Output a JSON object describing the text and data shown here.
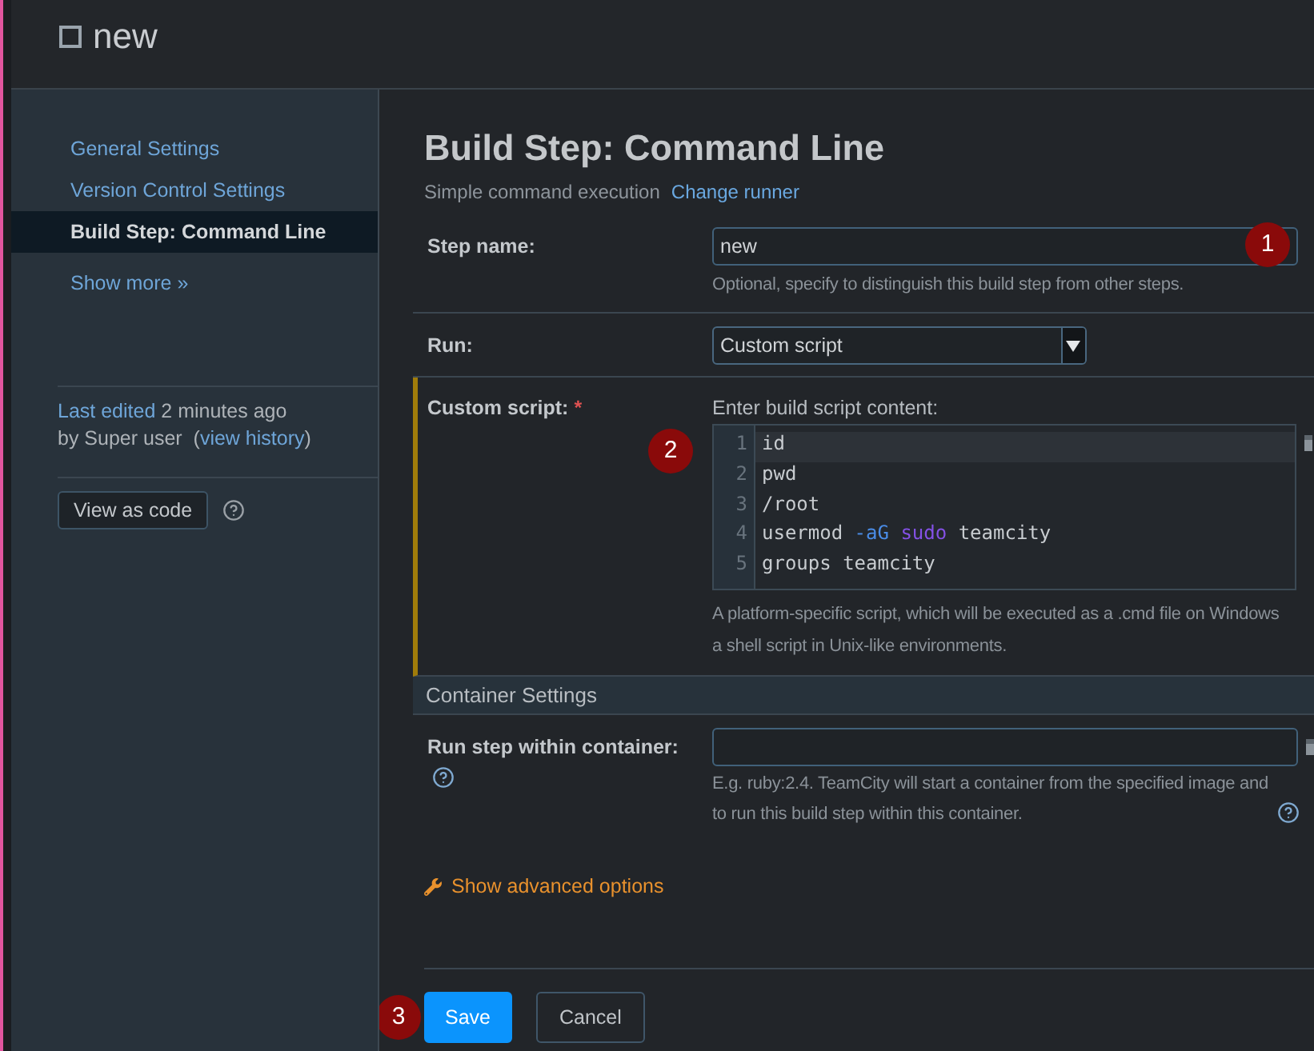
{
  "header": {
    "title": "new"
  },
  "sidebar": {
    "items": [
      {
        "label": "General Settings",
        "selected": false
      },
      {
        "label": "Version Control Settings",
        "selected": false
      },
      {
        "label": "Build Step: Command Line",
        "selected": true
      }
    ],
    "show_more": "Show more »",
    "edit_info": {
      "edited_link": "Last edited",
      "edited_time": "2 minutes ago",
      "author": "by Super user",
      "history_open": "(",
      "history_link": "view history",
      "history_close": ")"
    },
    "view_as_code": "View as code"
  },
  "form": {
    "title": "Build Step: Command Line",
    "runner": "Simple command execution",
    "change_runner": "Change runner",
    "step_name": {
      "label": "Step name:",
      "value": "new",
      "marker": "1",
      "hint": "Optional, specify to distinguish this build step from other steps."
    },
    "run": {
      "label": "Run:",
      "value": "Custom script"
    },
    "custom_script": {
      "label": "Custom script:",
      "required_mark": "*",
      "prompt": "Enter build script content:",
      "marker": "2",
      "lines": [
        {
          "number": "1",
          "active": true,
          "tokens": [
            {
              "text": "id",
              "kind": "plain"
            }
          ]
        },
        {
          "number": "2",
          "active": false,
          "tokens": [
            {
              "text": "pwd",
              "kind": "plain"
            }
          ]
        },
        {
          "number": "3",
          "active": false,
          "tokens": [
            {
              "text": "/root",
              "kind": "plain"
            }
          ]
        },
        {
          "number": "4",
          "active": false,
          "tokens": [
            {
              "text": "usermod ",
              "kind": "plain"
            },
            {
              "text": "-aG ",
              "kind": "flag"
            },
            {
              "text": "sudo",
              "kind": "keyword"
            },
            {
              "text": " teamcity",
              "kind": "plain"
            }
          ]
        },
        {
          "number": "5",
          "active": false,
          "tokens": [
            {
              "text": "groups teamcity",
              "kind": "plain"
            }
          ]
        }
      ],
      "hint_lines": [
        "A platform-specific script, which will be executed as a .cmd file on Windows",
        "a shell script in Unix-like environments."
      ]
    },
    "container": {
      "title": "Container Settings",
      "label": "Run step within container:",
      "hint_lines": [
        "E.g. ruby:2.4. TeamCity will start a container from the specified image and",
        "to run this build step within this container."
      ]
    },
    "advanced": "Show advanced options"
  },
  "footer": {
    "marker": "3",
    "buttons": [
      {
        "label": "Save",
        "kind": "primary"
      },
      {
        "label": "Cancel",
        "kind": "secondary"
      }
    ]
  }
}
